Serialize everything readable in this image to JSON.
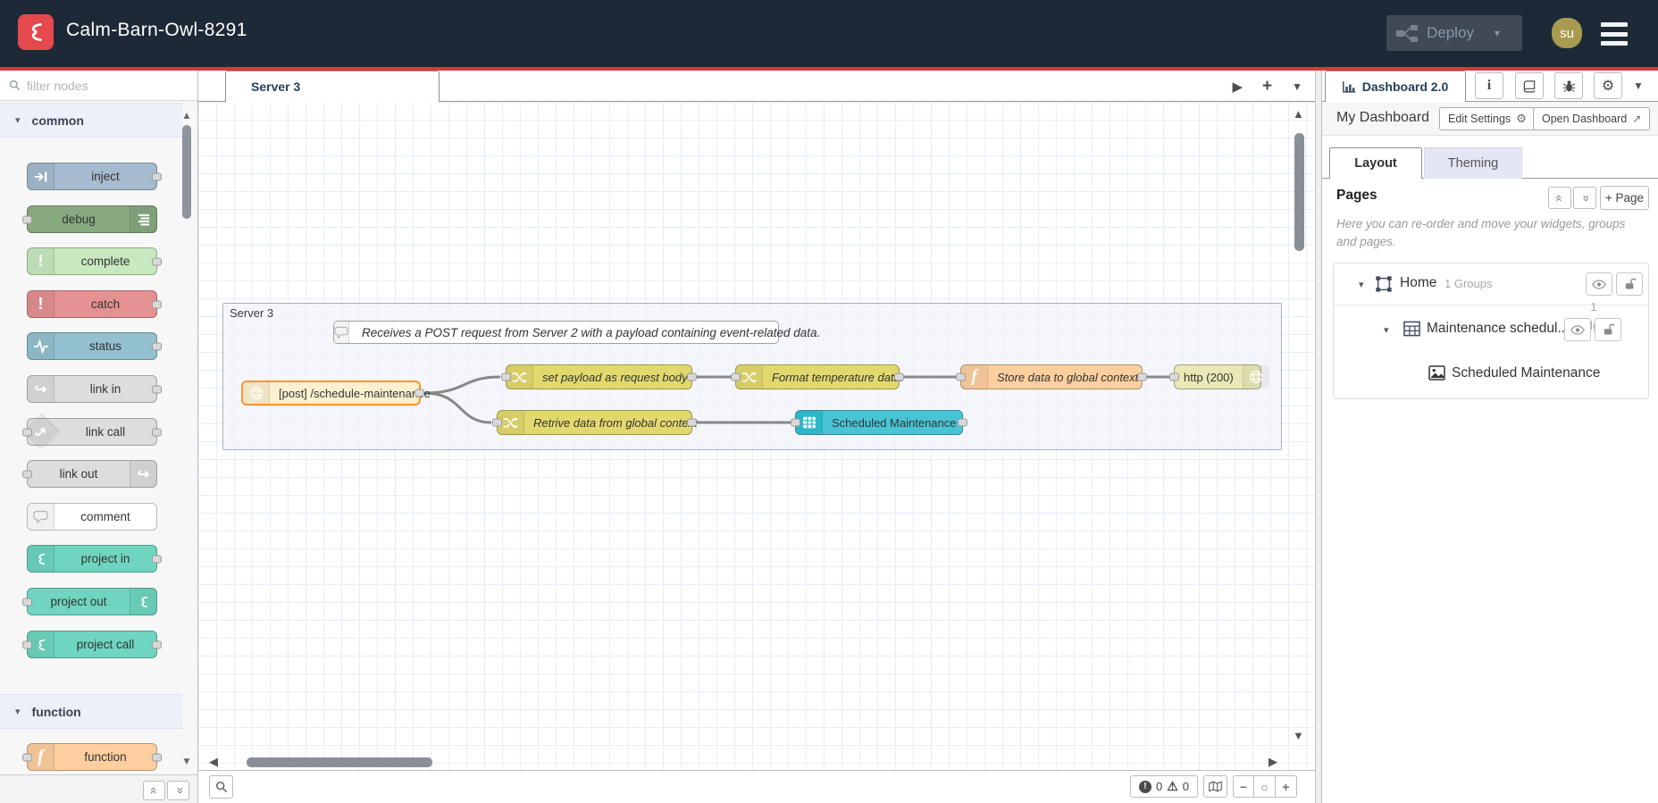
{
  "header": {
    "title": "Calm-Barn-Owl-8291",
    "deploy_label": "Deploy",
    "user_initials": "su"
  },
  "palette": {
    "filter_placeholder": "filter nodes",
    "categories": [
      {
        "label": "common",
        "items": [
          {
            "label": "inject"
          },
          {
            "label": "debug"
          },
          {
            "label": "complete"
          },
          {
            "label": "catch"
          },
          {
            "label": "status"
          },
          {
            "label": "link in"
          },
          {
            "label": "link call"
          },
          {
            "label": "link out"
          },
          {
            "label": "comment"
          },
          {
            "label": "project in"
          },
          {
            "label": "project out"
          },
          {
            "label": "project call"
          }
        ]
      },
      {
        "label": "function",
        "items": [
          {
            "label": "function"
          }
        ]
      }
    ]
  },
  "workspace": {
    "tab_label": "Server 3",
    "group_label": "Server 3",
    "comment_text": "Receives a POST request from Server 2 with a payload containing event-related data.",
    "nodes": [
      {
        "label": "[post] /schedule-maintenance",
        "type": "http in"
      },
      {
        "label": "set payload as request body",
        "type": "change"
      },
      {
        "label": "Format temperature data.",
        "type": "change"
      },
      {
        "label": "Store data to global context",
        "type": "function"
      },
      {
        "label": "http (200)",
        "type": "http response"
      },
      {
        "label": "Retrive data from global context",
        "type": "change"
      },
      {
        "label": "Scheduled Maintenance",
        "type": "ui-table"
      }
    ],
    "status": {
      "errors": "0",
      "warnings": "0"
    }
  },
  "sidebar": {
    "tab_label": "Dashboard 2.0",
    "dashboard_name": "My Dashboard",
    "buttons": {
      "edit_settings": "Edit Settings",
      "open_dashboard": "Open Dashboard"
    },
    "tabs": {
      "layout": "Layout",
      "theming": "Theming"
    },
    "pages": {
      "heading": "Pages",
      "add_page": "+ Page",
      "hint": "Here you can re-order and move your widgets, groups and pages."
    },
    "tree": {
      "page_name": "Home",
      "page_meta": "1 Groups",
      "group_name": "Maintenance schedul...",
      "group_meta_count": "1",
      "group_meta_label": "Widgets",
      "widget_name": "Scheduled Maintenance"
    }
  },
  "colors": {
    "header_bg": "#1d2936",
    "accent_red": "#d23b3b",
    "logo_red": "#e5484d",
    "avatar_bg": "#a89b4f",
    "deploy_bg": "#3f4a55",
    "node_inject": "#a6bbcf",
    "node_debug": "#87a980",
    "node_complete": "#c7e9c0",
    "node_catch": "#e49191",
    "node_status": "#94c1d0",
    "node_link": "#dddddd",
    "node_comment": "#ffffff",
    "node_project": "#6fd5c0",
    "node_function": "#fdcf9f",
    "node_change": "#e2d96e",
    "node_http_response": "#e9e8b6",
    "node_http_in": "#fcf1cf",
    "node_http_in_border": "#ff9331",
    "node_ui_table": "#49c4d6"
  }
}
